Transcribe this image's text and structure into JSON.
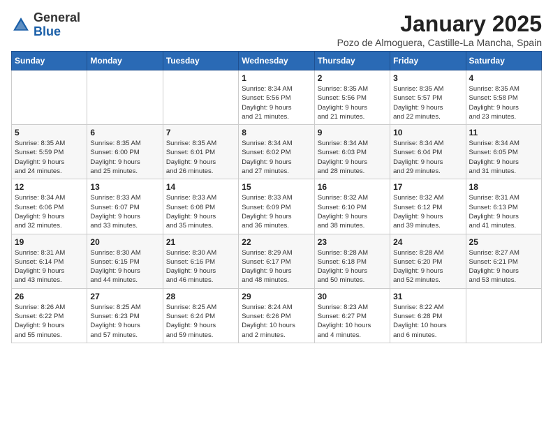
{
  "header": {
    "logo_general": "General",
    "logo_blue": "Blue",
    "month_title": "January 2025",
    "location": "Pozo de Almoguera, Castille-La Mancha, Spain"
  },
  "days_of_week": [
    "Sunday",
    "Monday",
    "Tuesday",
    "Wednesday",
    "Thursday",
    "Friday",
    "Saturday"
  ],
  "weeks": [
    [
      {
        "day": "",
        "info": ""
      },
      {
        "day": "",
        "info": ""
      },
      {
        "day": "",
        "info": ""
      },
      {
        "day": "1",
        "info": "Sunrise: 8:34 AM\nSunset: 5:56 PM\nDaylight: 9 hours\nand 21 minutes."
      },
      {
        "day": "2",
        "info": "Sunrise: 8:35 AM\nSunset: 5:56 PM\nDaylight: 9 hours\nand 21 minutes."
      },
      {
        "day": "3",
        "info": "Sunrise: 8:35 AM\nSunset: 5:57 PM\nDaylight: 9 hours\nand 22 minutes."
      },
      {
        "day": "4",
        "info": "Sunrise: 8:35 AM\nSunset: 5:58 PM\nDaylight: 9 hours\nand 23 minutes."
      }
    ],
    [
      {
        "day": "5",
        "info": "Sunrise: 8:35 AM\nSunset: 5:59 PM\nDaylight: 9 hours\nand 24 minutes."
      },
      {
        "day": "6",
        "info": "Sunrise: 8:35 AM\nSunset: 6:00 PM\nDaylight: 9 hours\nand 25 minutes."
      },
      {
        "day": "7",
        "info": "Sunrise: 8:35 AM\nSunset: 6:01 PM\nDaylight: 9 hours\nand 26 minutes."
      },
      {
        "day": "8",
        "info": "Sunrise: 8:34 AM\nSunset: 6:02 PM\nDaylight: 9 hours\nand 27 minutes."
      },
      {
        "day": "9",
        "info": "Sunrise: 8:34 AM\nSunset: 6:03 PM\nDaylight: 9 hours\nand 28 minutes."
      },
      {
        "day": "10",
        "info": "Sunrise: 8:34 AM\nSunset: 6:04 PM\nDaylight: 9 hours\nand 29 minutes."
      },
      {
        "day": "11",
        "info": "Sunrise: 8:34 AM\nSunset: 6:05 PM\nDaylight: 9 hours\nand 31 minutes."
      }
    ],
    [
      {
        "day": "12",
        "info": "Sunrise: 8:34 AM\nSunset: 6:06 PM\nDaylight: 9 hours\nand 32 minutes."
      },
      {
        "day": "13",
        "info": "Sunrise: 8:33 AM\nSunset: 6:07 PM\nDaylight: 9 hours\nand 33 minutes."
      },
      {
        "day": "14",
        "info": "Sunrise: 8:33 AM\nSunset: 6:08 PM\nDaylight: 9 hours\nand 35 minutes."
      },
      {
        "day": "15",
        "info": "Sunrise: 8:33 AM\nSunset: 6:09 PM\nDaylight: 9 hours\nand 36 minutes."
      },
      {
        "day": "16",
        "info": "Sunrise: 8:32 AM\nSunset: 6:10 PM\nDaylight: 9 hours\nand 38 minutes."
      },
      {
        "day": "17",
        "info": "Sunrise: 8:32 AM\nSunset: 6:12 PM\nDaylight: 9 hours\nand 39 minutes."
      },
      {
        "day": "18",
        "info": "Sunrise: 8:31 AM\nSunset: 6:13 PM\nDaylight: 9 hours\nand 41 minutes."
      }
    ],
    [
      {
        "day": "19",
        "info": "Sunrise: 8:31 AM\nSunset: 6:14 PM\nDaylight: 9 hours\nand 43 minutes."
      },
      {
        "day": "20",
        "info": "Sunrise: 8:30 AM\nSunset: 6:15 PM\nDaylight: 9 hours\nand 44 minutes."
      },
      {
        "day": "21",
        "info": "Sunrise: 8:30 AM\nSunset: 6:16 PM\nDaylight: 9 hours\nand 46 minutes."
      },
      {
        "day": "22",
        "info": "Sunrise: 8:29 AM\nSunset: 6:17 PM\nDaylight: 9 hours\nand 48 minutes."
      },
      {
        "day": "23",
        "info": "Sunrise: 8:28 AM\nSunset: 6:18 PM\nDaylight: 9 hours\nand 50 minutes."
      },
      {
        "day": "24",
        "info": "Sunrise: 8:28 AM\nSunset: 6:20 PM\nDaylight: 9 hours\nand 52 minutes."
      },
      {
        "day": "25",
        "info": "Sunrise: 8:27 AM\nSunset: 6:21 PM\nDaylight: 9 hours\nand 53 minutes."
      }
    ],
    [
      {
        "day": "26",
        "info": "Sunrise: 8:26 AM\nSunset: 6:22 PM\nDaylight: 9 hours\nand 55 minutes."
      },
      {
        "day": "27",
        "info": "Sunrise: 8:25 AM\nSunset: 6:23 PM\nDaylight: 9 hours\nand 57 minutes."
      },
      {
        "day": "28",
        "info": "Sunrise: 8:25 AM\nSunset: 6:24 PM\nDaylight: 9 hours\nand 59 minutes."
      },
      {
        "day": "29",
        "info": "Sunrise: 8:24 AM\nSunset: 6:26 PM\nDaylight: 10 hours\nand 2 minutes."
      },
      {
        "day": "30",
        "info": "Sunrise: 8:23 AM\nSunset: 6:27 PM\nDaylight: 10 hours\nand 4 minutes."
      },
      {
        "day": "31",
        "info": "Sunrise: 8:22 AM\nSunset: 6:28 PM\nDaylight: 10 hours\nand 6 minutes."
      },
      {
        "day": "",
        "info": ""
      }
    ]
  ]
}
